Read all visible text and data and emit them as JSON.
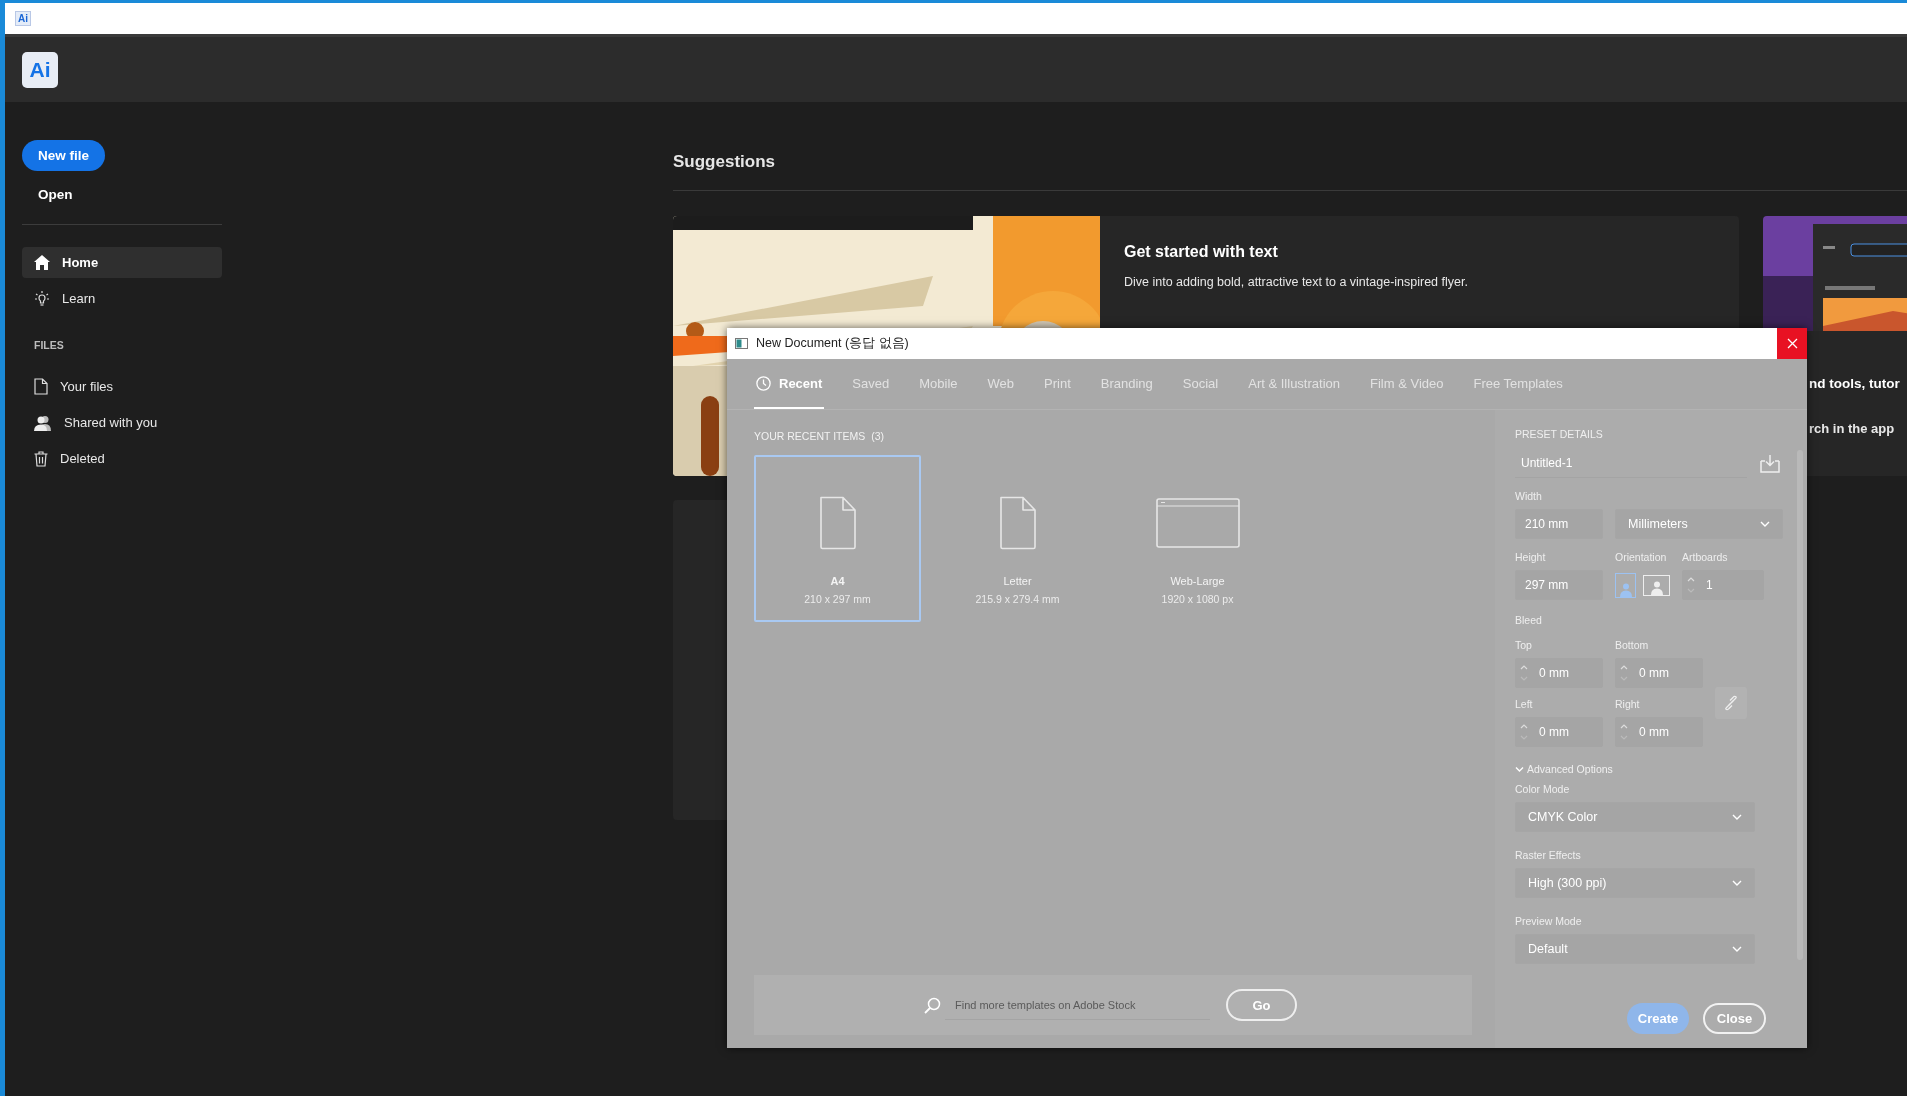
{
  "titlebar": {
    "logo": "Ai"
  },
  "app": {
    "logo": "Ai"
  },
  "sidebar": {
    "primary_button": "New file",
    "open": "Open",
    "nav": [
      {
        "label": "Home",
        "selected": true
      },
      {
        "label": "Learn",
        "selected": false
      }
    ],
    "section": "FILES",
    "files": [
      {
        "label": "Your files",
        "selected": false
      },
      {
        "label": "Shared with you",
        "selected": false
      },
      {
        "label": "Deleted",
        "selected": false
      }
    ]
  },
  "suggestions": {
    "title": "Suggestions",
    "cards": [
      {
        "kind": "picture",
        "title": "Get started with text",
        "description": "Dive into adding bold, attractive text to a vintage-inspired flyer."
      },
      {
        "kind": "picture",
        "title": "nd tools, tutor",
        "description": "rch in the app"
      }
    ]
  },
  "dialog": {
    "title": "New Document (응답 없음)",
    "tabs": [
      {
        "label": "Recent",
        "selected": true
      },
      {
        "label": "Saved",
        "selected": false
      },
      {
        "label": "Mobile",
        "selected": false
      },
      {
        "label": "Web",
        "selected": false
      },
      {
        "label": "Print",
        "selected": false
      },
      {
        "label": "Branding",
        "selected": false
      },
      {
        "label": "Social",
        "selected": false
      },
      {
        "label": "Art & Illustration",
        "selected": false
      },
      {
        "label": "Film & Video",
        "selected": false
      },
      {
        "label": "Free Templates",
        "selected": false
      }
    ],
    "recent_heading": "YOUR RECENT ITEMS",
    "recent_count": "(3)",
    "recent_items": [
      {
        "kind": "page",
        "name": "A4",
        "size": "210 x 297 mm",
        "selected": true
      },
      {
        "kind": "page",
        "name": "Letter",
        "size": "215.9 x 279.4 mm",
        "selected": false
      },
      {
        "kind": "web",
        "name": "Web-Large",
        "size": "1920 x 1080 px",
        "selected": false
      }
    ],
    "search": {
      "placeholder": "Find more templates on Adobe Stock",
      "button": "Go"
    },
    "preset": {
      "heading": "PRESET DETAILS",
      "name": "Untitled-1",
      "width_label": "Width",
      "width": "210 mm",
      "units": "Millimeters",
      "height_label": "Height",
      "height": "297 mm",
      "orientation_label": "Orientation",
      "orientations": [
        {
          "kind": "portrait",
          "selected": true
        },
        {
          "kind": "landscape",
          "selected": false
        }
      ],
      "artboards_label": "Artboards",
      "artboards": "1",
      "bleed_label": "Bleed",
      "bleed": [
        {
          "label": "Top",
          "value": "0 mm"
        },
        {
          "label": "Bottom",
          "value": "0 mm"
        },
        {
          "label": "Left",
          "value": "0 mm"
        },
        {
          "label": "Right",
          "value": "0 mm"
        }
      ],
      "advanced": {
        "label": "Advanced Options",
        "expanded": true
      },
      "dropdowns": [
        {
          "label": "Color Mode",
          "value": "CMYK Color"
        },
        {
          "label": "Raster Effects",
          "value": "High (300 ppi)"
        },
        {
          "label": "Preview Mode",
          "value": "Default"
        }
      ]
    },
    "buttons": [
      {
        "kind": "primary",
        "label": "Create"
      },
      {
        "kind": "secondary",
        "label": "Close"
      }
    ]
  }
}
